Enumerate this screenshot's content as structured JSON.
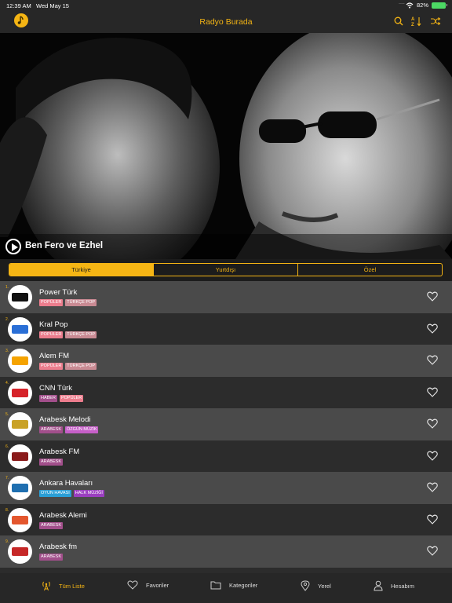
{
  "status": {
    "time": "12:39 AM",
    "date": "Wed May 15",
    "dots": "....",
    "battery": "82%"
  },
  "nav": {
    "title": "Radyo Burada",
    "icons": [
      "app-logo-icon",
      "search-icon",
      "sort-az-icon",
      "shuffle-icon"
    ]
  },
  "hero": {
    "title": "Ben Fero ve Ezhel"
  },
  "segments": [
    "Türkiye",
    "Yurtdışı",
    "Özel"
  ],
  "colors": {
    "accent": "#f5b514",
    "tag_pink": "#ec7d8d",
    "tag_rose": "#c98a93",
    "tag_purple": "#c65fc8",
    "tag_blue": "#2a9fd6",
    "tag_plum": "#a24f8b"
  },
  "stations": [
    {
      "num": "1.",
      "name": "Power Türk",
      "tags": [
        {
          "label": "POPÜLER",
          "color": "#ec7d8d"
        },
        {
          "label": "TÜRKÇE POP",
          "color": "#c98a93"
        }
      ]
    },
    {
      "num": "2.",
      "name": "Kral Pop",
      "tags": [
        {
          "label": "POPÜLER",
          "color": "#ec7d8d"
        },
        {
          "label": "TÜRKÇE POP",
          "color": "#c98a93"
        }
      ]
    },
    {
      "num": "3.",
      "name": "Alem FM",
      "tags": [
        {
          "label": "POPÜLER",
          "color": "#ec7d8d"
        },
        {
          "label": "TÜRKÇE POP",
          "color": "#c98a93"
        }
      ]
    },
    {
      "num": "4.",
      "name": "CNN Türk",
      "tags": [
        {
          "label": "HABER",
          "color": "#a24f8b"
        },
        {
          "label": "POPÜLER",
          "color": "#ec7d8d"
        }
      ]
    },
    {
      "num": "5.",
      "name": "Arabesk Melodi",
      "tags": [
        {
          "label": "ARABESK",
          "color": "#a24f8b"
        },
        {
          "label": "ÖZGÜN MÜZİK",
          "color": "#c65fc8"
        }
      ]
    },
    {
      "num": "6.",
      "name": "Arabesk FM",
      "tags": [
        {
          "label": "ARABESK",
          "color": "#a24f8b"
        }
      ]
    },
    {
      "num": "7.",
      "name": "Ankara Havaları",
      "tags": [
        {
          "label": "OYUN HAVASI",
          "color": "#2a9fd6"
        },
        {
          "label": "HALK MÜZİĞİ",
          "color": "#9b3fc0"
        }
      ]
    },
    {
      "num": "8.",
      "name": "Arabesk Alemi",
      "tags": [
        {
          "label": "ARABESK",
          "color": "#a24f8b"
        }
      ]
    },
    {
      "num": "9.",
      "name": "Arabesk fm",
      "tags": [
        {
          "label": "ARABESK",
          "color": "#a24f8b"
        }
      ]
    }
  ],
  "tabs": [
    {
      "label": "Tüm Liste",
      "icon": "radio-tower-icon"
    },
    {
      "label": "Favoriler",
      "icon": "heart-icon"
    },
    {
      "label": "Kategoriler",
      "icon": "folder-icon"
    },
    {
      "label": "Yerel",
      "icon": "location-pin-icon"
    },
    {
      "label": "Hesabım",
      "icon": "user-icon"
    }
  ]
}
